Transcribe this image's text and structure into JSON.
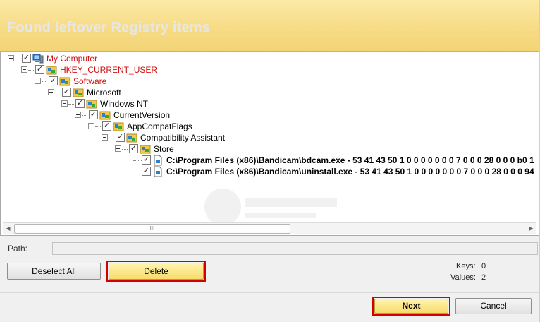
{
  "header": {
    "title": "Found leftover Registry items"
  },
  "tree": {
    "items": [
      {
        "label": "My Computer"
      },
      {
        "label": "HKEY_CURRENT_USER"
      },
      {
        "label": "Software"
      },
      {
        "label": "Microsoft"
      },
      {
        "label": "Windows NT"
      },
      {
        "label": "CurrentVersion"
      },
      {
        "label": "AppCompatFlags"
      },
      {
        "label": "Compatibility Assistant"
      },
      {
        "label": "Store"
      },
      {
        "label": "C:\\Program Files (x86)\\Bandicam\\bdcam.exe - 53 41 43 50 1 0 0 0 0 0 0 0 7 0 0 0 28 0 0 0 b0 1"
      },
      {
        "label": "C:\\Program Files (x86)\\Bandicam\\uninstall.exe - 53 41 43 50 1 0 0 0 0 0 0 0 7 0 0 0 28 0 0 0 94"
      }
    ],
    "check_mark": "✓",
    "scroll_grip": "III"
  },
  "path": {
    "label": "Path:",
    "value": ""
  },
  "buttons": {
    "deselect_all": "Deselect All",
    "delete": "Delete",
    "next": "Next",
    "cancel": "Cancel"
  },
  "stats": {
    "keys_label": "Keys:",
    "keys_value": "0",
    "values_label": "Values:",
    "values_value": "2"
  },
  "colors": {
    "header": "#f7dc86",
    "highlight": "#d40000",
    "red_text": "#d21010"
  }
}
